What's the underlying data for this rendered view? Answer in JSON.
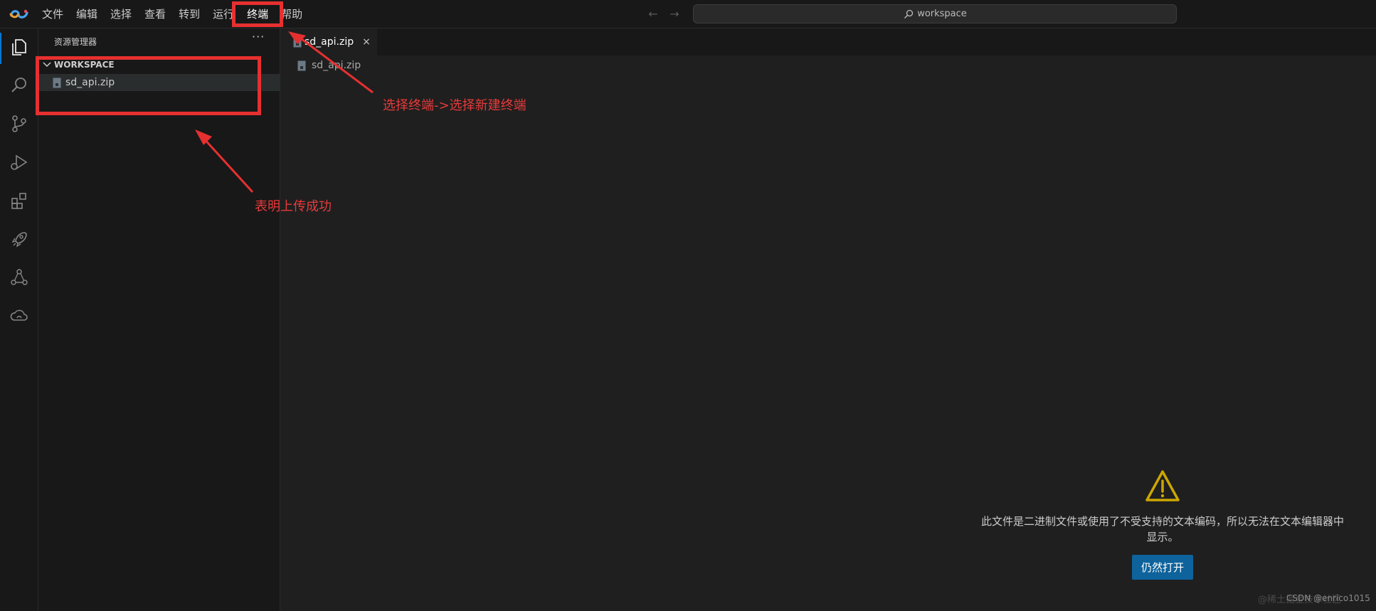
{
  "titlebar": {
    "menu": [
      "文件",
      "编辑",
      "选择",
      "查看",
      "转到",
      "运行",
      "终端",
      "帮助"
    ],
    "search_text": "workspace"
  },
  "activitybar": {
    "items": [
      "explorer-icon",
      "search-icon",
      "source-control-icon",
      "run-debug-icon",
      "extensions-icon",
      "rocket-icon",
      "share-icon",
      "cloud-icon"
    ]
  },
  "sidebar": {
    "title": "资源管理器",
    "more": "···",
    "section": "WORKSPACE",
    "files": [
      "sd_api.zip"
    ]
  },
  "editor": {
    "tab_label": "sd_api.zip",
    "tab_close": "×",
    "breadcrumb": "sd_api.zip",
    "notice": "此文件是二进制文件或使用了不受支持的文本编码，所以无法在文本编辑器中显示。",
    "open_anyway": "仍然打开"
  },
  "annotations": {
    "terminal_hint": "选择终端->选择新建终端",
    "upload_hint": "表明上传成功"
  },
  "watermark": {
    "left": "@稀土掘金技术社区",
    "csdn": "CSDN @enrico1015"
  },
  "colors": {
    "accent": "#0078d4",
    "annotation": "#e63030",
    "warning": "#cca700",
    "button": "#0e639c"
  }
}
